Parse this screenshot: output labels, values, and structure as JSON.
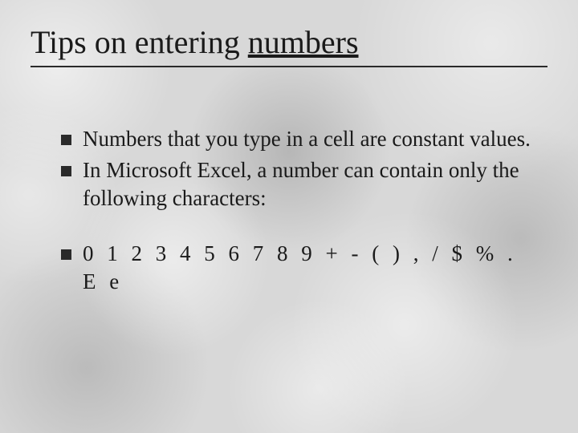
{
  "title": {
    "prefix": "Tips on entering ",
    "underlined": "numbers"
  },
  "bullets": {
    "b1": "Numbers that you type in a cell are constant values.",
    "b2": "In Microsoft Excel, a number can contain only the following characters:",
    "b3_line1": "0  1  2  3  4  5  6  7  8  9  +  -  (  )  ,  /  $  %  .",
    "b3_line2": "E  e"
  }
}
